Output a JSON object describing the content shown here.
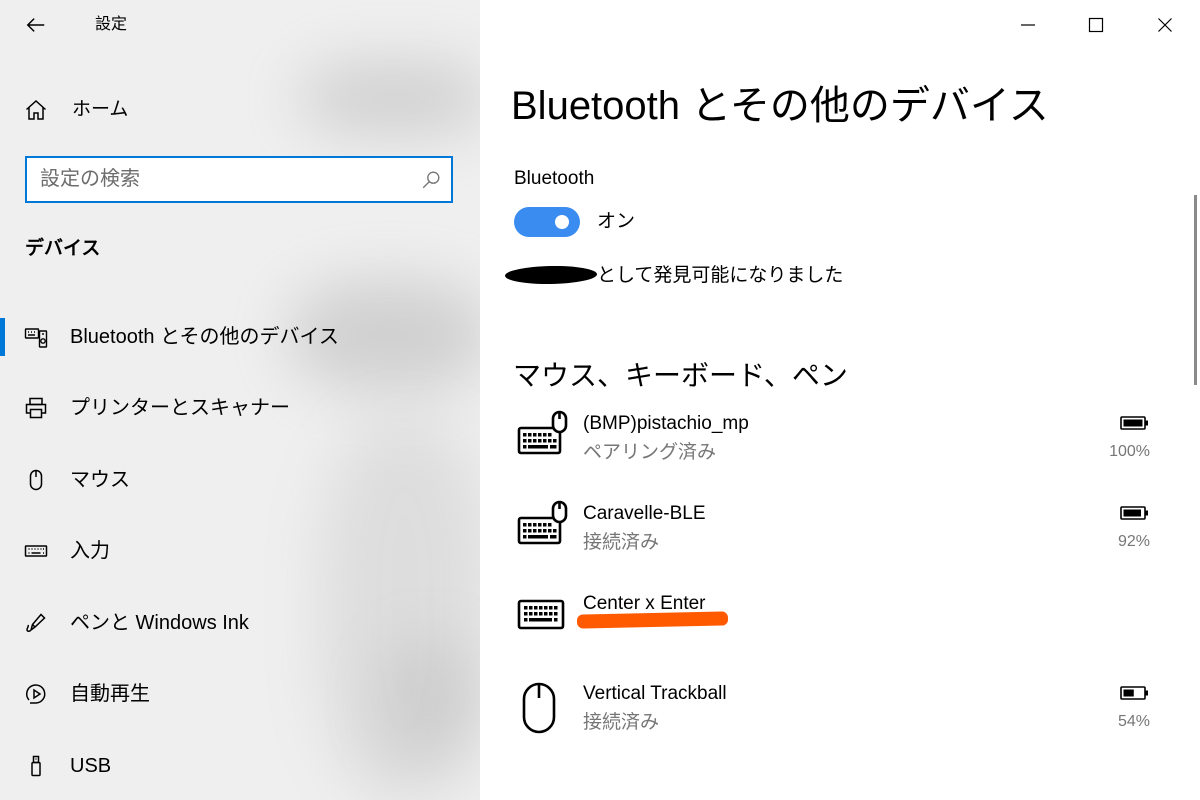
{
  "window": {
    "app_title": "設定",
    "controls": {
      "back": "back-arrow-icon",
      "minimize": "minimize-icon",
      "maximize": "maximize-icon",
      "close": "close-icon"
    }
  },
  "sidebar": {
    "home_label": "ホーム",
    "home_icon": "home-icon",
    "search_placeholder": "設定の検索",
    "search_icon": "search-icon",
    "section_heading": "デバイス",
    "items": [
      {
        "label": "Bluetooth とその他のデバイス",
        "icon": "bluetooth-devices-icon",
        "selected": true
      },
      {
        "label": "プリンターとスキャナー",
        "icon": "printer-icon",
        "selected": false
      },
      {
        "label": "マウス",
        "icon": "mouse-icon",
        "selected": false
      },
      {
        "label": "入力",
        "icon": "keyboard-icon",
        "selected": false
      },
      {
        "label": "ペンと Windows Ink",
        "icon": "pen-icon",
        "selected": false
      },
      {
        "label": "自動再生",
        "icon": "autoplay-icon",
        "selected": false
      },
      {
        "label": "USB",
        "icon": "usb-icon",
        "selected": false
      }
    ]
  },
  "main": {
    "title": "Bluetooth とその他のデバイス",
    "bluetooth_label": "Bluetooth",
    "bluetooth_toggle": {
      "on": true,
      "state_label": "オン"
    },
    "discoverable_text": "として発見可能になりました",
    "section_title": "マウス、キーボード、ペン",
    "devices": [
      {
        "name": "(BMP)pistachio_mp",
        "status": "ペアリング済み",
        "battery": "100%",
        "icon": "keyboard-mouse-icon"
      },
      {
        "name": "Caravelle-BLE",
        "status": "接続済み",
        "battery": "92%",
        "icon": "keyboard-mouse-icon"
      },
      {
        "name": "Center x Enter",
        "icon": "keyboard-icon"
      },
      {
        "name": "Vertical Trackball",
        "status": "接続済み",
        "battery": "54%",
        "icon": "mouse-icon"
      }
    ]
  },
  "colors": {
    "accent": "#0078d7",
    "toggle_on": "#3a8cf0",
    "selected_indicator": "#0078d7",
    "redaction": "#000000",
    "scribble": "#ff5a00"
  }
}
